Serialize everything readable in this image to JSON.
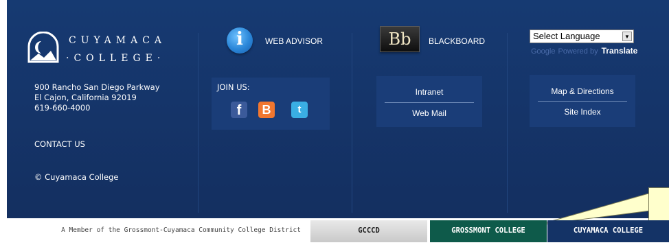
{
  "logo": {
    "line1": "CUYAMACA",
    "line2": "·COLLEGE·"
  },
  "address": {
    "street": "900 Rancho San Diego Parkway",
    "city": "El Cajon, California 92019",
    "phone": "619-660-4000"
  },
  "contact_label": "CONTACT US",
  "copyright": "© Cuyamaca College",
  "web_advisor": {
    "icon": "info-icon",
    "glyph": "i",
    "label": "WEB ADVISOR"
  },
  "join": {
    "label": "JOIN US:",
    "social": [
      {
        "icon": "facebook-icon",
        "glyph": "f"
      },
      {
        "icon": "blogger-icon",
        "glyph": "B"
      },
      {
        "icon": "twitter-icon",
        "glyph": "t"
      }
    ]
  },
  "blackboard": {
    "icon": "blackboard-icon",
    "glyph": "Bb",
    "label": "BLACKBOARD"
  },
  "links_left": {
    "intranet": "Intranet",
    "web_mail": "Web Mail"
  },
  "links_right": {
    "map": "Map & Directions",
    "site_index": "Site Index"
  },
  "translate": {
    "select_value": "Select Language",
    "google": "Google",
    "powered_by": "Powered by",
    "translate": "Translate"
  },
  "bottom": {
    "member_text": "A Member of the Grossmont-Cuyamaca Community College District",
    "tabs": [
      "GCCCD",
      "GROSSMONT COLLEGE",
      "CUYAMACA COLLEGE"
    ]
  },
  "colors": {
    "footer_bg": "#143366",
    "panel_bg": "#1a3d78",
    "grossmont_green": "#0e5a4a",
    "callout_yellow": "#ffffcc"
  }
}
